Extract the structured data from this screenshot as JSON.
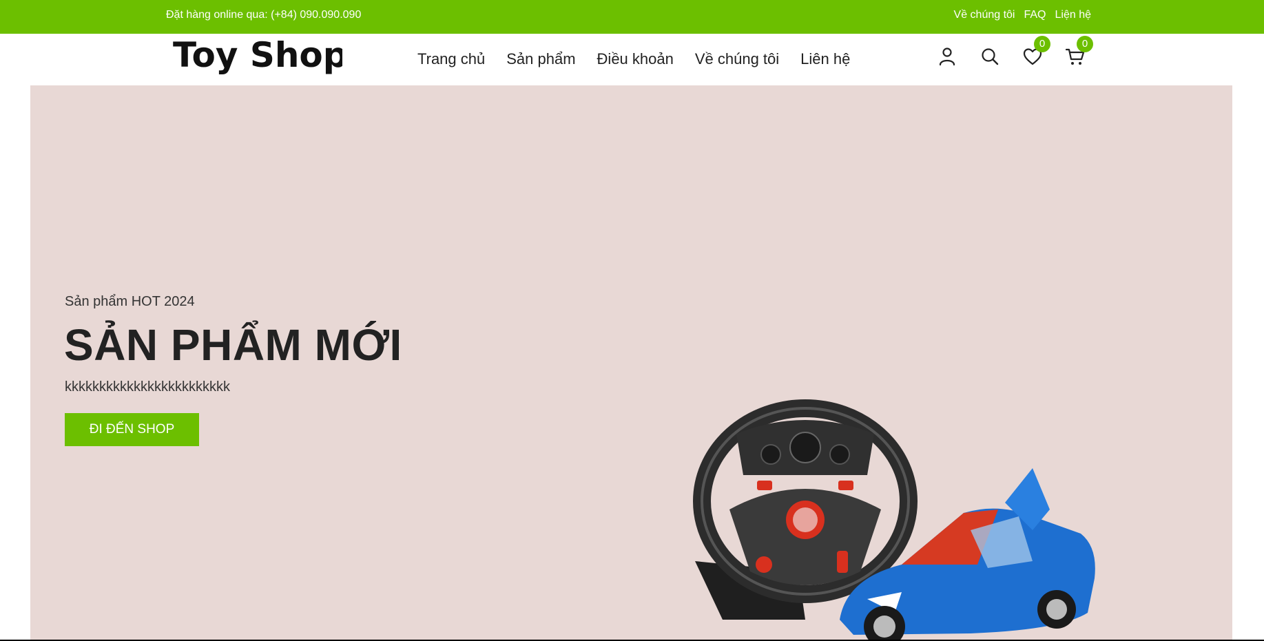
{
  "topbar": {
    "phone_text": "Đặt hàng online qua: (+84) 090.090.090",
    "links": [
      "Về chúng tôi",
      "FAQ",
      "Liện hệ"
    ]
  },
  "header": {
    "logo_text": "Toy Shop",
    "nav": [
      "Trang chủ",
      "Sản phẩm",
      "Điều khoản",
      "Về chúng tôi",
      "Liên hệ"
    ],
    "icons": {
      "account": "user-icon",
      "search": "search-icon",
      "wishlist": "heart-icon",
      "cart": "cart-icon"
    },
    "wishlist_count": "0",
    "cart_count": "0"
  },
  "hero": {
    "eyebrow": "Sản phẩm HOT 2024",
    "title": "SẢN PHẨM MỚI",
    "description": "kkkkkkkkkkkkkkkkkkkkkkkk",
    "cta_label": "ĐI ĐẾN SHOP",
    "product_image": "steering-wheel-and-rc-car"
  },
  "colors": {
    "accent": "#6cbf00",
    "hero_bg": "#e8d8d5",
    "text": "#222222"
  }
}
